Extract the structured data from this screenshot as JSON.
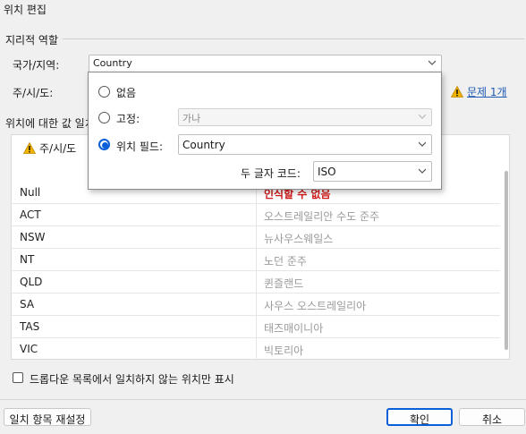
{
  "window": {
    "title": "위치 편집"
  },
  "geo_roles": {
    "group_title": "지리적 역할",
    "country_label": "국가/지역:",
    "country_value": "Country",
    "state_label": "주/시/도:",
    "issue_link": "문제 1개"
  },
  "matching": {
    "section_title": "위치에 대한 값 일치",
    "col1_header": "주/시/도",
    "rows": [
      {
        "value": "Null",
        "match": "인식할 수 없음",
        "unrecognized": true
      },
      {
        "value": "ACT",
        "match": "오스트레일리안 수도 준주"
      },
      {
        "value": "NSW",
        "match": "뉴사우스웨일스"
      },
      {
        "value": "NT",
        "match": "노던 준주"
      },
      {
        "value": "QLD",
        "match": "퀸즐랜드"
      },
      {
        "value": "SA",
        "match": "사우스 오스트레일리아"
      },
      {
        "value": "TAS",
        "match": "태즈매이니아"
      },
      {
        "value": "VIC",
        "match": "빅토리아"
      }
    ]
  },
  "popup": {
    "option_none": "없음",
    "option_fixed": "고정:",
    "fixed_value": "가나",
    "option_field": "위치 필드:",
    "field_value": "Country",
    "code_label": "두 글자 코드:",
    "code_value": "ISO",
    "selected": "option_field"
  },
  "footer": {
    "checkbox_label": "드롭다운 목록에서 일치하지 않는 위치만 표시",
    "reset_button": "일치 항목 재설정",
    "ok_button": "확인",
    "cancel_button": "취소"
  },
  "colors": {
    "accent": "#0a5ed7",
    "warning": "#f0b400",
    "error": "#d11a1a",
    "link": "#1f5bb5"
  }
}
